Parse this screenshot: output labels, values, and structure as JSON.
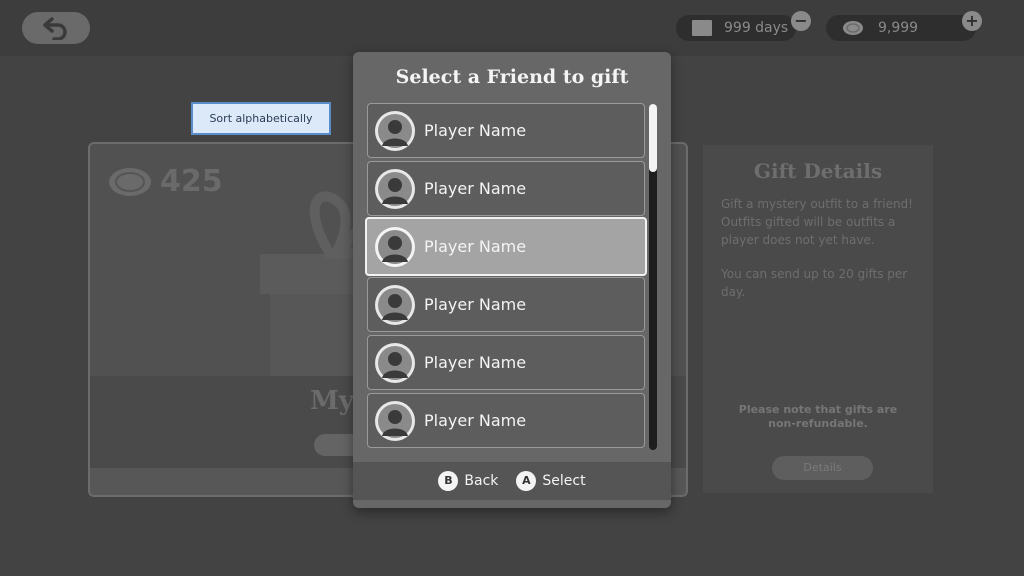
{
  "header": {
    "days_value": "999 days",
    "coins_value": "9,999"
  },
  "tooltip": {
    "label": "Sort alphabetically"
  },
  "gift_card": {
    "price": "425",
    "name": "Mys"
  },
  "details": {
    "title": "Gift Details",
    "description": "Gift a mystery outfit to a friend! Outfits gifted will be outfits a player does not yet have.",
    "limit_text": "You can send up to 20 gifts per day.",
    "note": "Please note that gifts are non-refundable.",
    "button_label": "Details"
  },
  "modal": {
    "title": "Select a Friend to gift",
    "friends": [
      {
        "name": "Player Name",
        "selected": false
      },
      {
        "name": "Player Name",
        "selected": false
      },
      {
        "name": "Player Name",
        "selected": true
      },
      {
        "name": "Player Name",
        "selected": false
      },
      {
        "name": "Player Name",
        "selected": false
      },
      {
        "name": "Player Name",
        "selected": false
      }
    ],
    "footer": {
      "back_key": "B",
      "back_label": "Back",
      "select_key": "A",
      "select_label": "Select"
    }
  },
  "colors": {
    "background": "#434343",
    "modal": "#676767",
    "selected_row": "#a4a4a4",
    "tooltip_bg": "#dbe9f9",
    "tooltip_border": "#5a8cc9"
  }
}
